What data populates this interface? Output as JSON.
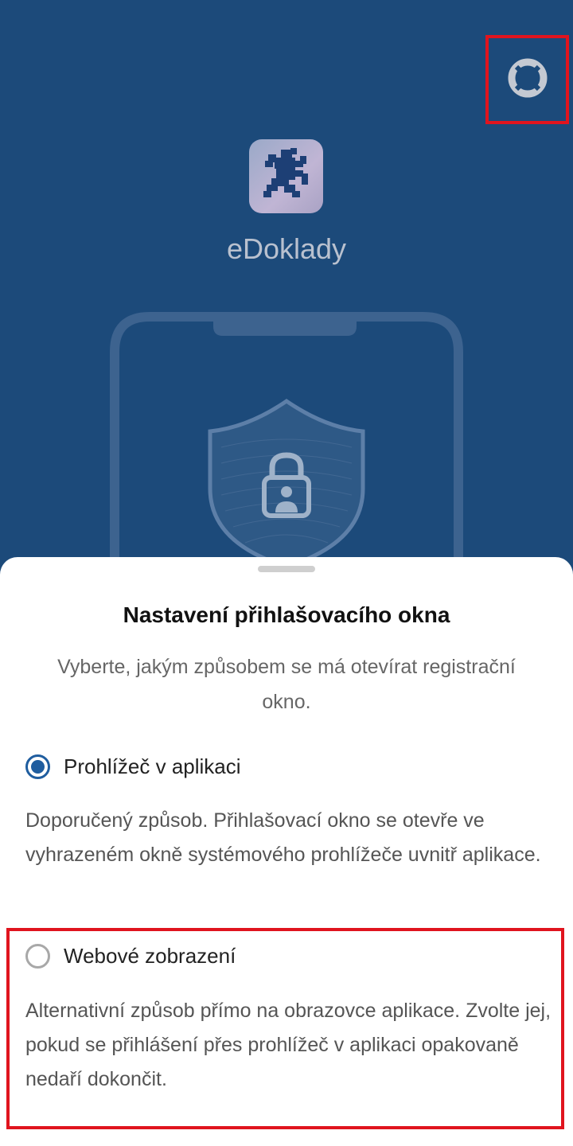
{
  "header": {
    "help_icon": "lifebuoy-icon",
    "app_logo_icon": "czech-lion-icon",
    "app_name": "eDoklady",
    "illustration": "phone-shield-lock-icon"
  },
  "sheet": {
    "title": "Nastavení přihlašovacího okna",
    "subtitle": "Vyberte, jakým způsobem se má otevírat registrační okno.",
    "options": [
      {
        "label": "Prohlížeč v aplikaci",
        "selected": true,
        "description": "Doporučený způsob. Přihlašovací okno se otevře ve vyhrazeném okně systémového prohlížeče uvnitř aplikace."
      },
      {
        "label": "Webové zobrazení",
        "selected": false,
        "description": "Alternativní způsob přímo na obrazovce aplikace. Zvolte jej, pokud se přihlášení přes prohlížeč v aplikaci opakovaně nedaří dokončit."
      }
    ]
  },
  "colors": {
    "background": "#1c4a7a",
    "accent": "#1f5d9f",
    "highlight": "#e0141e"
  }
}
